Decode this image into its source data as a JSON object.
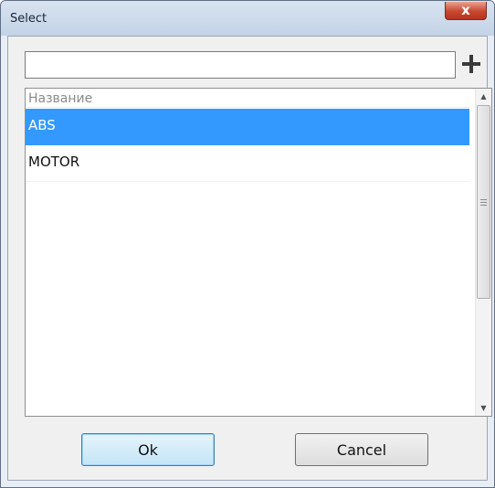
{
  "window": {
    "title": "Select",
    "close_glyph": "x"
  },
  "search": {
    "value": "",
    "placeholder": ""
  },
  "add_button": {
    "icon": "plus-icon"
  },
  "list": {
    "column_header": "Название",
    "items": [
      {
        "label": "ABS",
        "selected": true
      },
      {
        "label": "MOTOR",
        "selected": false
      }
    ]
  },
  "buttons": {
    "ok_label": "Ok",
    "cancel_label": "Cancel"
  },
  "colors": {
    "selection": "#3399ff",
    "close_button": "#c7482f",
    "ok_border": "#3c7fb1"
  }
}
